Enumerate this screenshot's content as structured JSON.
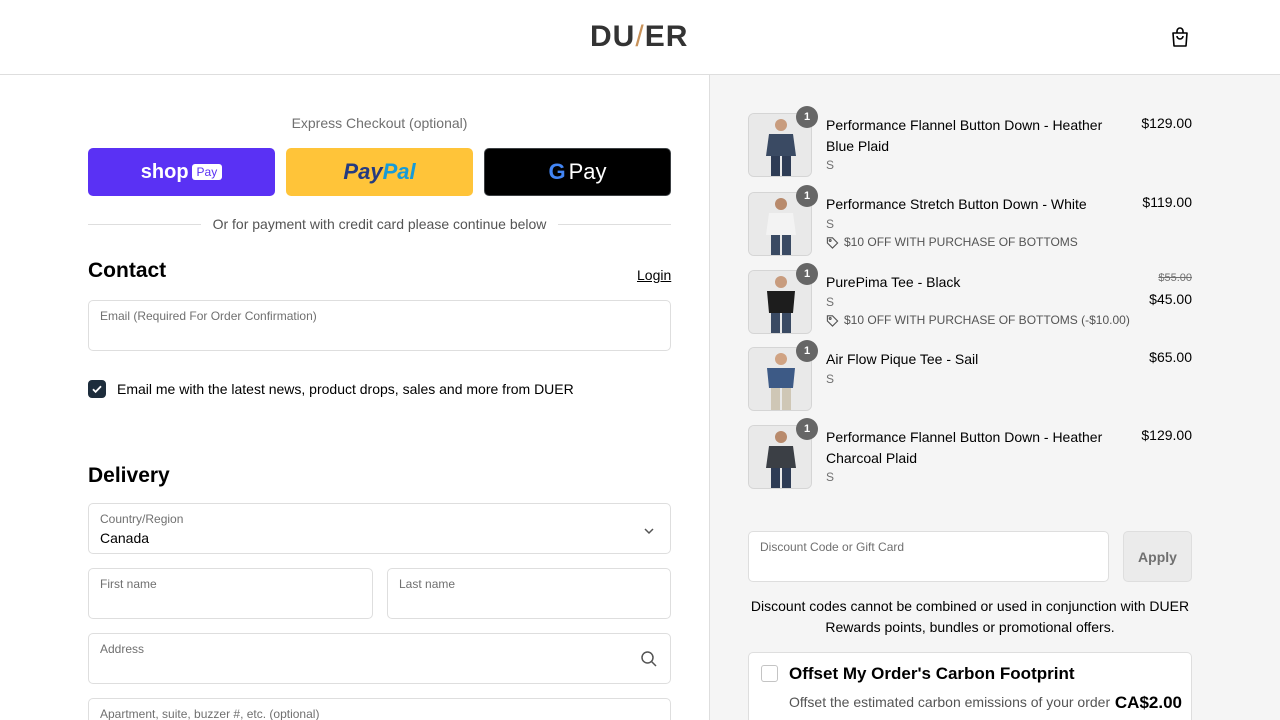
{
  "header": {
    "logo_left": "DU",
    "logo_slash": "/",
    "logo_right": "ER",
    "cart_icon": "shopping-bag-icon"
  },
  "express": {
    "title": "Express Checkout (optional)",
    "shop_label": "shop",
    "shop_pay": "Pay",
    "paypal_1": "Pay",
    "paypal_2": "Pal",
    "gpay_g": "G",
    "gpay_label": "Pay",
    "divider_text": "Or for payment with credit card please continue below"
  },
  "contact": {
    "title": "Contact",
    "login": "Login",
    "email_label": "Email (Required For Order Confirmation)",
    "email_value": "",
    "newsletter_label": "Email me with the latest news, product drops, sales and more from DUER",
    "newsletter_checked": true
  },
  "delivery": {
    "title": "Delivery",
    "country_label": "Country/Region",
    "country_value": "Canada",
    "first_name_label": "First name",
    "last_name_label": "Last name",
    "address_label": "Address",
    "apartment_label": "Apartment, suite, buzzer #, etc. (optional)"
  },
  "cart": {
    "items": [
      {
        "name": "Performance Flannel Button Down - Heather Blue Plaid",
        "variant": "S",
        "qty": "1",
        "price": "$129.00",
        "shirt_color": "#3a4a63"
      },
      {
        "name": "Performance Stretch Button Down - White",
        "variant": "S",
        "qty": "1",
        "price": "$119.00",
        "discount": "$10 OFF WITH PURCHASE OF BOTTOMS",
        "shirt_color": "#f3f3f3"
      },
      {
        "name": "PurePima Tee - Black",
        "variant": "S",
        "qty": "1",
        "old_price": "$55.00",
        "price": "$45.00",
        "discount": "$10 OFF WITH PURCHASE OF BOTTOMS (-$10.00)",
        "shirt_color": "#1d1d1d"
      },
      {
        "name": "Air Flow Pique Tee - Sail",
        "variant": "S",
        "qty": "1",
        "price": "$65.00",
        "shirt_color": "#3d5a86"
      },
      {
        "name": "Performance Flannel Button Down - Heather Charcoal Plaid",
        "variant": "S",
        "qty": "1",
        "price": "$129.00",
        "shirt_color": "#3b3f45"
      }
    ],
    "discount_label": "Discount Code or Gift Card",
    "apply": "Apply",
    "discount_note": "Discount codes cannot be combined or used in conjunction with DUER Rewards points, bundles or promotional offers.",
    "carbon_title": "Offset My Order's Carbon Footprint",
    "carbon_desc": "Offset the estimated carbon emissions of your order",
    "carbon_price": "CA$2.00"
  }
}
